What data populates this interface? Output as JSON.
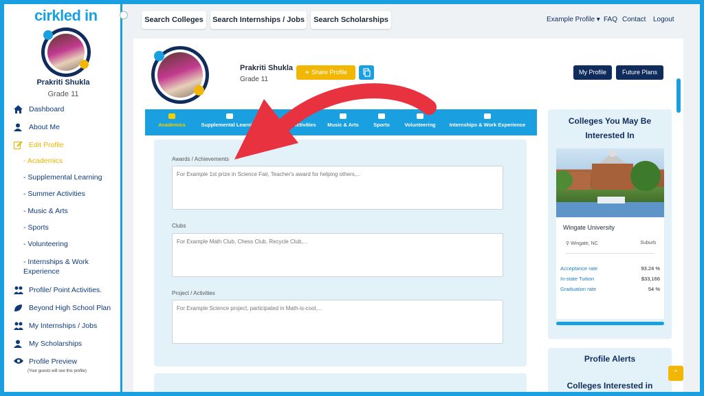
{
  "app": {
    "logo": "cirkled in"
  },
  "sidebar": {
    "name": "Prakriti Shukla",
    "grade": "Grade 11",
    "items": [
      {
        "label": "Dashboard",
        "icon": "home-icon"
      },
      {
        "label": "About Me",
        "icon": "user-icon"
      },
      {
        "label": "Edit Profile",
        "icon": "edit-icon"
      },
      {
        "label": "- Academics"
      },
      {
        "label": "- Supplemental Learning"
      },
      {
        "label": "- Summer Activities"
      },
      {
        "label": "- Music & Arts"
      },
      {
        "label": "- Sports"
      },
      {
        "label": "- Volunteering"
      },
      {
        "label": "- Internships & Work Experience"
      },
      {
        "label": "Profile/ Point Activities.",
        "icon": "users-icon"
      },
      {
        "label": "Beyond High School Plan",
        "icon": "leaf-icon"
      },
      {
        "label": "My Internships / Jobs",
        "icon": "users-icon"
      },
      {
        "label": "My Scholarships",
        "icon": "user-icon"
      },
      {
        "label": "Profile Preview",
        "icon": "eye-icon"
      }
    ],
    "preview_note": "(Your guests will see this profile)"
  },
  "topbar": {
    "search_colleges": "Search Colleges",
    "search_internships": "Search Internships / Jobs",
    "search_scholarships": "Search Scholarships",
    "example_profile": "Example Profile ▾",
    "faq": "FAQ",
    "contact": "Contact",
    "logout": "Logout"
  },
  "profile": {
    "name": "Prakriti Shukla",
    "grade": "Grade 11",
    "share_label": "Share Profile",
    "my_profile": "My Profile",
    "future_plans": "Future Plans"
  },
  "tabs": [
    "Academics",
    "Supplemental Learning",
    "Summer Activities",
    "Music & Arts",
    "Sports",
    "Volunteering",
    "Internships & Work Experience"
  ],
  "form": {
    "awards_label": "Awards / Achievements",
    "awards_placeholder": "For Example 1st prize in Science Fair, Teacher's award for helping others,...",
    "clubs_label": "Clubs",
    "clubs_placeholder": "For Example Math Club, Chess Club, Recycle Club,...",
    "projects_label": "Project / Activities",
    "projects_placeholder": "For Example Science project, participated in Math-is-cool,..."
  },
  "colleges": {
    "title": "Colleges You May Be Interested In",
    "university": "Wingate University",
    "location": "Wingate, NC",
    "setting": "Suburb",
    "stats": [
      {
        "label": "Acceptance rate",
        "value": "93.24 %"
      },
      {
        "label": "In-state Tuition",
        "value": "$33,166"
      },
      {
        "label": "Graduation rate",
        "value": "54 %"
      }
    ]
  },
  "alerts": {
    "title": "Profile Alerts",
    "subtitle": "Colleges Interested in"
  },
  "colors": {
    "accent": "#1a9fe0",
    "navy": "#0f2c5c",
    "gold": "#f2b705",
    "arrow": "#e8323f"
  }
}
